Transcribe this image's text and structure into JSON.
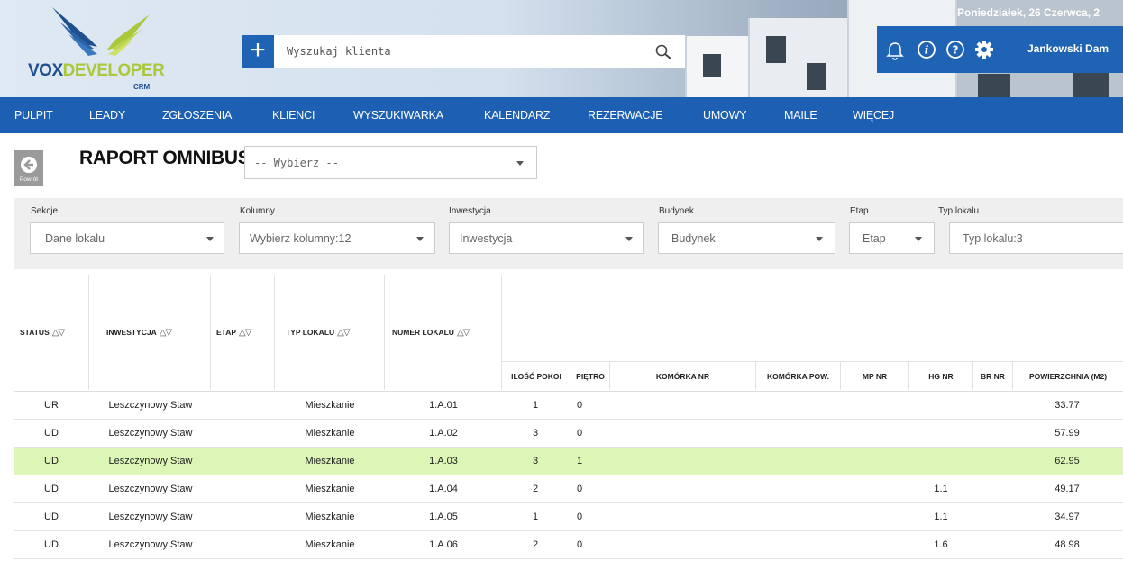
{
  "header": {
    "date": "Poniedziałek, 26 Czerwca, 2",
    "user": "Jankowski Dam",
    "logo": {
      "vox": "VOX",
      "dev": "DEVELOPER",
      "crm": "CRM"
    },
    "add_label": "+",
    "search": {
      "placeholder": "Wyszukaj klienta",
      "value": ""
    },
    "icons": [
      "bell-icon",
      "info-icon",
      "help-icon",
      "gear-icon",
      "search-icon",
      "plus-icon"
    ],
    "colors": {
      "brand_blue": "#1c5fb3",
      "logo_green": "#a9c93a",
      "highlight_row": "#dcf6b6"
    }
  },
  "nav": {
    "items": [
      {
        "label": "PULPIT"
      },
      {
        "label": "LEADY"
      },
      {
        "label": "ZGŁOSZENIA"
      },
      {
        "label": "KLIENCI"
      },
      {
        "label": "WYSZUKIWARKA"
      },
      {
        "label": "KALENDARZ"
      },
      {
        "label": "REZERWACJE"
      },
      {
        "label": "UMOWY"
      },
      {
        "label": "MAILE"
      },
      {
        "label": "WIĘCEJ"
      }
    ]
  },
  "page": {
    "back_label": "Powrót",
    "title": "RAPORT OMNIBUS",
    "report_select": "-- Wybierz --"
  },
  "filters": {
    "sekcje": {
      "label": "Sekcje",
      "value": "Dane lokalu"
    },
    "kolumny": {
      "label": "Kolumny",
      "value": "Wybierz kolumny:12"
    },
    "inwestycja": {
      "label": "Inwestycja",
      "value": "Inwestycja"
    },
    "budynek": {
      "label": "Budynek",
      "value": "Budynek"
    },
    "etap": {
      "label": "Etap",
      "value": "Etap"
    },
    "typ": {
      "label": "Typ lokalu",
      "value": "Typ lokalu:3"
    }
  },
  "table": {
    "sortable_headers": {
      "status": "STATUS",
      "inwestycja": "INWESTYCJA",
      "etap": "ETAP",
      "typ": "TYP LOKALU",
      "numer": "NUMER LOKALU"
    },
    "sub_headers": {
      "pokoi": "ILOŚĆ POKOI",
      "pietro": "PIĘTRO",
      "komorka_nr": "KOMÓRKA NR",
      "komorka_pow": "KOMÓRKA POW.",
      "mp_nr": "MP NR",
      "hg_nr": "HG NR",
      "br_nr": "BR NR",
      "powierzchnia": "POWIERZCHNIA (M2)"
    },
    "sort_glyph": "△▽",
    "rows": [
      {
        "status": "UR",
        "inwestycja": "Leszczynowy Staw",
        "etap": "",
        "typ": "Mieszkanie",
        "numer": "1.A.01",
        "pokoi": "1",
        "pietro": "0",
        "komorka_nr": "",
        "komorka_pow": "",
        "mp_nr": "",
        "hg_nr": "",
        "br_nr": "",
        "powierzchnia": "33.77",
        "highlighted": false
      },
      {
        "status": "UD",
        "inwestycja": "Leszczynowy Staw",
        "etap": "",
        "typ": "Mieszkanie",
        "numer": "1.A.02",
        "pokoi": "3",
        "pietro": "0",
        "komorka_nr": "",
        "komorka_pow": "",
        "mp_nr": "",
        "hg_nr": "",
        "br_nr": "",
        "powierzchnia": "57.99",
        "highlighted": false
      },
      {
        "status": "UD",
        "inwestycja": "Leszczynowy Staw",
        "etap": "",
        "typ": "Mieszkanie",
        "numer": "1.A.03",
        "pokoi": "3",
        "pietro": "1",
        "komorka_nr": "",
        "komorka_pow": "",
        "mp_nr": "",
        "hg_nr": "",
        "br_nr": "",
        "powierzchnia": "62.95",
        "highlighted": true
      },
      {
        "status": "UD",
        "inwestycja": "Leszczynowy Staw",
        "etap": "",
        "typ": "Mieszkanie",
        "numer": "1.A.04",
        "pokoi": "2",
        "pietro": "0",
        "komorka_nr": "",
        "komorka_pow": "",
        "mp_nr": "",
        "hg_nr": "1.1",
        "br_nr": "",
        "powierzchnia": "49.17",
        "highlighted": false
      },
      {
        "status": "UD",
        "inwestycja": "Leszczynowy Staw",
        "etap": "",
        "typ": "Mieszkanie",
        "numer": "1.A.05",
        "pokoi": "1",
        "pietro": "0",
        "komorka_nr": "",
        "komorka_pow": "",
        "mp_nr": "",
        "hg_nr": "1.1",
        "br_nr": "",
        "powierzchnia": "34.97",
        "highlighted": false
      },
      {
        "status": "UD",
        "inwestycja": "Leszczynowy Staw",
        "etap": "",
        "typ": "Mieszkanie",
        "numer": "1.A.06",
        "pokoi": "2",
        "pietro": "0",
        "komorka_nr": "",
        "komorka_pow": "",
        "mp_nr": "",
        "hg_nr": "1.6",
        "br_nr": "",
        "powierzchnia": "48.98",
        "highlighted": false
      }
    ]
  }
}
